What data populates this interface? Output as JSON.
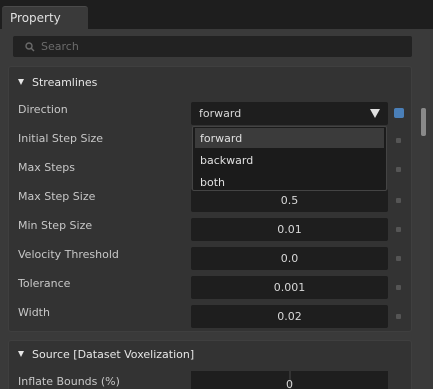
{
  "tab": {
    "label": "Property"
  },
  "search": {
    "placeholder": "Search"
  },
  "sections": [
    {
      "title": "Streamlines"
    },
    {
      "title": "Source [Dataset Voxelization]"
    }
  ],
  "streamlines": {
    "direction": {
      "label": "Direction",
      "value": "forward",
      "options": [
        "forward",
        "backward",
        "both"
      ],
      "selected": "forward"
    },
    "rows": [
      {
        "label": "Initial Step Size",
        "value": ""
      },
      {
        "label": "Max Steps",
        "value": ""
      },
      {
        "label": "Max Step Size",
        "value": "0.5"
      },
      {
        "label": "Min Step Size",
        "value": "0.01"
      },
      {
        "label": "Velocity Threshold",
        "value": "0.0"
      },
      {
        "label": "Tolerance",
        "value": "0.001"
      },
      {
        "label": "Width",
        "value": "0.02"
      }
    ]
  },
  "source": {
    "inflate_label": "Inflate Bounds (%)",
    "inflate_value": "0"
  },
  "colors": {
    "accent_blue": "#4a7fb8",
    "panel_bg": "#3a3a3a",
    "field_bg": "#1e1e1e"
  }
}
